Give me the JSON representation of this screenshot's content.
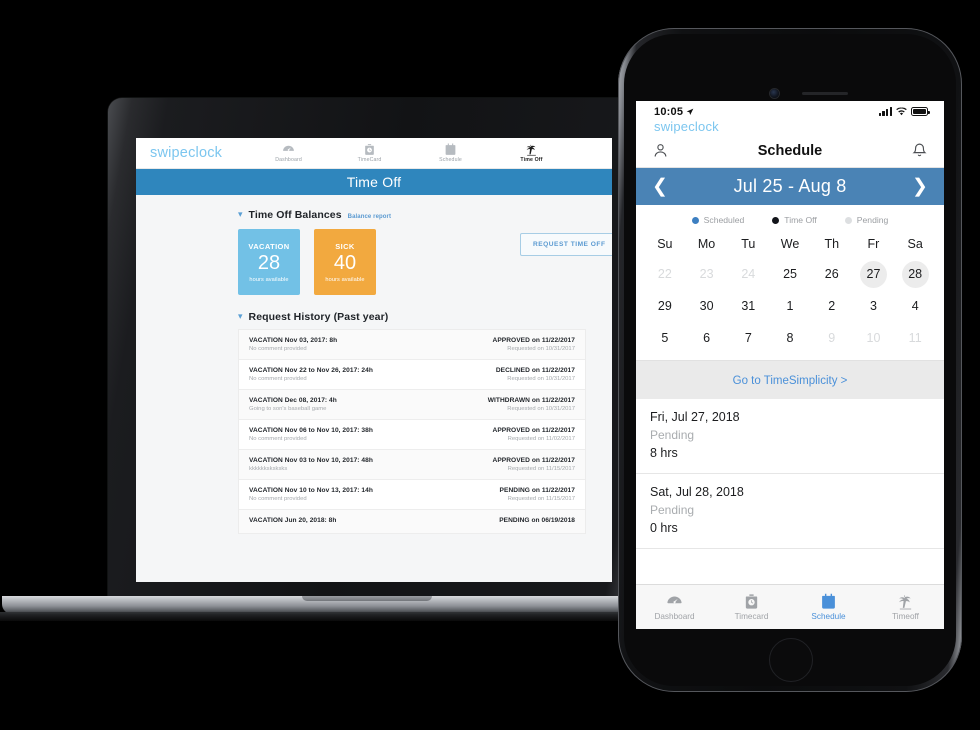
{
  "colors": {
    "header_blue": "#2f86bd",
    "phone_blue": "#4a83b5",
    "accent_link": "#4a90d9",
    "logo_blue": "#7cc6ef",
    "vacation_card": "#72c1e6",
    "sick_card": "#f2a93f"
  },
  "laptop": {
    "brand": "swipeclock",
    "nav": [
      {
        "label": "Dashboard",
        "icon": "dashboard-gauge-icon",
        "active": false
      },
      {
        "label": "TimeCard",
        "icon": "timecard-clock-icon",
        "active": false
      },
      {
        "label": "Schedule",
        "icon": "schedule-calendar-icon",
        "active": false
      },
      {
        "label": "Time Off",
        "icon": "timeoff-palm-tree-icon",
        "active": true
      }
    ],
    "page_title": "Time Off",
    "balances_section": {
      "title": "Time Off Balances",
      "link": "Balance report",
      "cards": [
        {
          "type": "VACATION",
          "value": "28",
          "unit": "hours available"
        },
        {
          "type": "SICK",
          "value": "40",
          "unit": "hours available"
        }
      ],
      "request_button": "REQUEST TIME OFF"
    },
    "history_section": {
      "title": "Request History (Past year)",
      "rows": [
        {
          "title": "VACATION Nov 03, 2017: 8h",
          "comment": "No comment provided",
          "status": "APPROVED on 11/22/2017",
          "requested": "Requested on 10/31/2017"
        },
        {
          "title": "VACATION Nov 22 to Nov 26, 2017: 24h",
          "comment": "No comment provided",
          "status": "DECLINED on 11/22/2017",
          "requested": "Requested on 10/31/2017"
        },
        {
          "title": "VACATION Dec 08, 2017: 4h",
          "comment": "Going to son's baseball game",
          "status": "WITHDRAWN on 11/22/2017",
          "requested": "Requested on 10/31/2017"
        },
        {
          "title": "VACATION Nov 06 to Nov 10, 2017: 38h",
          "comment": "No comment provided",
          "status": "APPROVED on 11/22/2017",
          "requested": "Requested on 11/02/2017"
        },
        {
          "title": "VACATION Nov 03 to Nov 10, 2017: 48h",
          "comment": "kkkkkksksksks",
          "status": "APPROVED on 11/22/2017",
          "requested": "Requested on 11/15/2017"
        },
        {
          "title": "VACATION Nov 10 to Nov 13, 2017: 14h",
          "comment": "No comment provided",
          "status": "PENDING on 11/22/2017",
          "requested": "Requested on 11/15/2017"
        },
        {
          "title": "VACATION Jun 20, 2018: 8h",
          "comment": "",
          "status": "PENDING on 06/19/2018",
          "requested": ""
        }
      ]
    }
  },
  "phone": {
    "status_bar": {
      "time": "10:05",
      "location_icon": "location-arrow-icon",
      "signal_icon": "cellular-bars-icon",
      "wifi_icon": "wifi-icon",
      "battery_icon": "battery-full-icon"
    },
    "brand": "swipeclock",
    "navbar": {
      "profile_icon": "person-icon",
      "title": "Schedule",
      "bell_icon": "bell-icon"
    },
    "week_nav": {
      "prev_icon": "chevron-left-icon",
      "label": "Jul 25 - Aug 8",
      "next_icon": "chevron-right-icon"
    },
    "legend": [
      {
        "label": "Scheduled",
        "color": "#3d7fc1"
      },
      {
        "label": "Time Off",
        "color": "#12141a"
      },
      {
        "label": "Pending",
        "color": "#dddfe1"
      }
    ],
    "calendar": {
      "weekdays": [
        "Su",
        "Mo",
        "Tu",
        "We",
        "Th",
        "Fr",
        "Sa"
      ],
      "weeks": [
        [
          {
            "d": "22",
            "muted": true
          },
          {
            "d": "23",
            "muted": true
          },
          {
            "d": "24",
            "muted": true
          },
          {
            "d": "25",
            "muted": false
          },
          {
            "d": "26",
            "muted": false
          },
          {
            "d": "27",
            "muted": false,
            "selected": true
          },
          {
            "d": "28",
            "muted": false,
            "selected": true
          }
        ],
        [
          {
            "d": "29",
            "muted": false
          },
          {
            "d": "30",
            "muted": false
          },
          {
            "d": "31",
            "muted": false
          },
          {
            "d": "1",
            "muted": false
          },
          {
            "d": "2",
            "muted": false
          },
          {
            "d": "3",
            "muted": false
          },
          {
            "d": "4",
            "muted": false
          }
        ],
        [
          {
            "d": "5",
            "muted": false
          },
          {
            "d": "6",
            "muted": false
          },
          {
            "d": "7",
            "muted": false
          },
          {
            "d": "8",
            "muted": false
          },
          {
            "d": "9",
            "muted": true
          },
          {
            "d": "10",
            "muted": true
          },
          {
            "d": "11",
            "muted": true
          }
        ]
      ]
    },
    "go_to_link": "Go to TimeSimplicity >",
    "events": [
      {
        "date": "Fri, Jul 27, 2018",
        "status": "Pending",
        "hours": "8 hrs"
      },
      {
        "date": "Sat, Jul 28, 2018",
        "status": "Pending",
        "hours": "0 hrs"
      }
    ],
    "tabs": [
      {
        "label": "Dashboard",
        "icon": "dashboard-gauge-icon",
        "active": false
      },
      {
        "label": "Timecard",
        "icon": "timecard-clock-icon",
        "active": false
      },
      {
        "label": "Schedule",
        "icon": "schedule-calendar-icon",
        "active": true
      },
      {
        "label": "Timeoff",
        "icon": "timeoff-palm-tree-icon",
        "active": false
      }
    ]
  }
}
